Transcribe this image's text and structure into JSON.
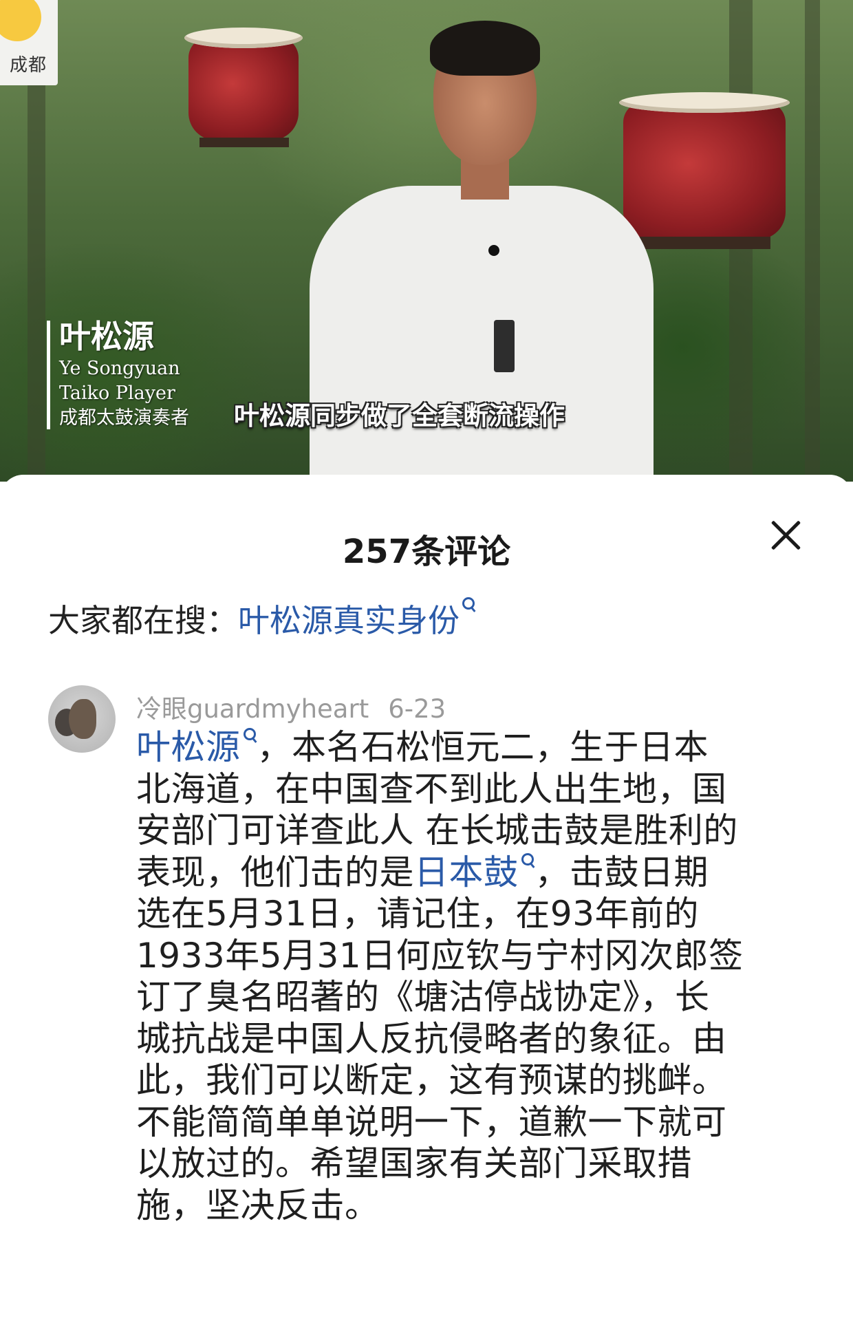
{
  "video": {
    "corner_logo_text": "成都",
    "lower_third": {
      "name": "叶松源",
      "name_en": "Ye Songyuan",
      "role_en": "Taiko Player",
      "role_zh": "成都太鼓演奏者"
    },
    "subtitle": "叶松源同步做了全套断流操作"
  },
  "comments_panel": {
    "title": "257条评论",
    "close_icon": "close-icon",
    "search_label": "大家都在搜：",
    "search_term": "叶松源真实身份"
  },
  "comment": {
    "username": "冷眼guardmyheart",
    "date": "6-23",
    "avatar_icon": "squirrel-avatar",
    "body": {
      "l1_link": "叶松源",
      "l1_rest": "，本名石松恒元二，生于日本",
      "l2": "北海道，在中国查不到此人出生地，国",
      "l3": "安部门可详查此人 在长城击鼓是胜利的",
      "l4_pre": "表现，他们击的是",
      "l4_link": "日本鼓",
      "l4_post": "，击鼓日期",
      "l5": "选在5月31日，请记住，在93年前的",
      "l6": "1933年5月31日何应钦与宁村冈次郎签",
      "l7": "订了臭名昭著的《塘沽停战协定》，长",
      "l8": "城抗战是中国人反抗侵略者的象征。由",
      "l9": "此，我们可以断定，这有预谋的挑衅。",
      "l10": "不能简简单单说明一下，道歉一下就可",
      "l11": "以放过的。希望国家有关部门采取措",
      "l12": "施，坚决反击。"
    }
  },
  "colors": {
    "link": "#2a5aa8",
    "meta": "#9a9a9a",
    "text": "#1f1f1f"
  }
}
